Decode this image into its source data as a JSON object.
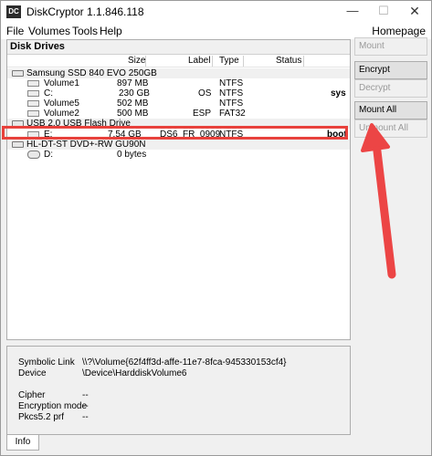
{
  "window": {
    "title": "DiskCryptor 1.1.846.118",
    "icon_label": "DC",
    "minimize_glyph": "—",
    "maximize_glyph": "☐",
    "close_glyph": "✕"
  },
  "menu": {
    "items": [
      "File",
      "Volumes",
      "Tools",
      "Help"
    ],
    "homepage": "Homepage"
  },
  "disk_panel": {
    "title": "Disk Drives",
    "columns": {
      "size": "Size",
      "label": "Label",
      "type": "Type",
      "status": "Status"
    }
  },
  "devices": [
    {
      "name": "Samsung SSD 840 EVO 250GB",
      "icon": "hard-disk-icon",
      "volumes": [
        {
          "name": "Volume1",
          "size": "897 MB",
          "label": "",
          "type": "NTFS",
          "status": ""
        },
        {
          "name": "C:",
          "size": "230 GB",
          "label": "OS",
          "type": "NTFS",
          "status": "sys"
        },
        {
          "name": "Volume5",
          "size": "502 MB",
          "label": "",
          "type": "NTFS",
          "status": ""
        },
        {
          "name": "Volume2",
          "size": "500 MB",
          "label": "ESP",
          "type": "FAT32",
          "status": ""
        }
      ]
    },
    {
      "name": "USB 2.0 USB Flash Drive",
      "icon": "usb-drive-icon",
      "volumes": [
        {
          "name": "E:",
          "size": "7.54 GB",
          "label": "DS6_FR_0909",
          "type": "NTFS",
          "status": "boot"
        }
      ]
    },
    {
      "name": "HL-DT-ST DVD+-RW GU90N",
      "icon": "optical-drive-icon",
      "volumes": [
        {
          "name": "D:",
          "size": "0 bytes",
          "label": "",
          "type": "",
          "status": ""
        }
      ]
    }
  ],
  "buttons": {
    "mount": "Mount",
    "encrypt": "Encrypt",
    "decrypt": "Decrypt",
    "mount_all": "Mount All",
    "unmount_all": "Unmount All"
  },
  "info": {
    "symbolic_link_label": "Symbolic Link",
    "symbolic_link_value": "\\\\?\\Volume{62f4ff3d-affe-11e7-8fca-945330153cf4}",
    "device_label": "Device",
    "device_value": "\\Device\\HarddiskVolume6",
    "cipher_label": "Cipher",
    "cipher_value": "--",
    "encryption_mode_label": "Encryption mode",
    "encryption_mode_value": "--",
    "pkcs_label": "Pkcs5.2 prf",
    "pkcs_value": "--",
    "tab_label": "Info"
  },
  "colors": {
    "highlight": "#e8413c",
    "arrow": "#ec4545"
  }
}
